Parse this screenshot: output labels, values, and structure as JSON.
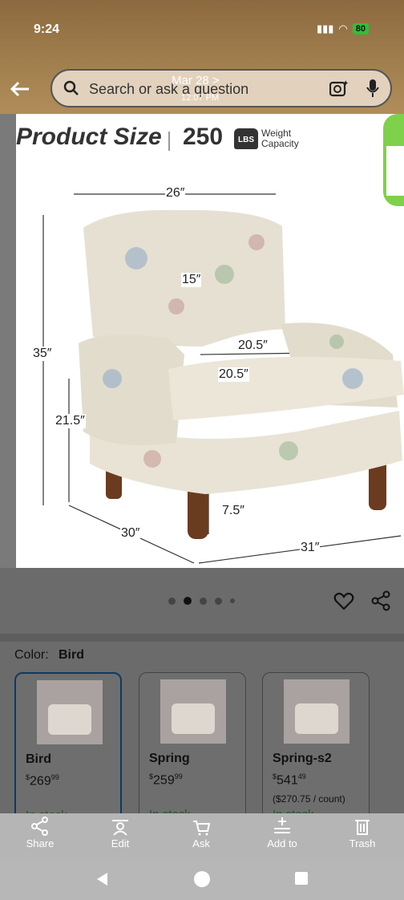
{
  "status": {
    "time": "9:24",
    "battery": "80"
  },
  "search": {
    "placeholder": "Search or ask a question"
  },
  "overlay": {
    "date": "Mar 28 >",
    "time": "12:07 PM"
  },
  "image": {
    "title": "Product Size",
    "capacity_value": "250",
    "capacity_unit": "LBS",
    "capacity_label": "Weight Capacity",
    "dims": {
      "width_top": "26″",
      "back_depth": "15″",
      "seat_width": "20.5″",
      "seat_depth": "20.5″",
      "height": "35″",
      "arm_height": "21.5″",
      "leg_height": "7.5″",
      "depth": "30″",
      "width": "31″"
    }
  },
  "carousel": {
    "count": 5,
    "active_index": 1
  },
  "color": {
    "label": "Color:",
    "value": "Bird"
  },
  "options": [
    {
      "name": "Bird",
      "currency": "$",
      "price": "269",
      "cents": "99",
      "stock": "In stock"
    },
    {
      "name": "Spring",
      "currency": "$",
      "price": "259",
      "cents": "99",
      "stock": "In stock"
    },
    {
      "name": "Spring-s2",
      "currency": "$",
      "price": "541",
      "cents": "49",
      "unit_price": "($270.75 / count)",
      "stock": "In stock"
    }
  ],
  "toolbar": {
    "share": "Share",
    "edit": "Edit",
    "ask": "Ask",
    "add_to": "Add to",
    "trash": "Trash"
  },
  "colors": {
    "header": "#a3804f",
    "selected_border": "#0b3a66",
    "badge_green": "#7fd04a"
  },
  "icons": [
    "search-icon",
    "lens-icon",
    "mic-icon",
    "back-arrow-icon",
    "heart-icon",
    "share-icon",
    "share-tool-icon",
    "edit-tool-icon",
    "ask-tool-icon",
    "add-to-tool-icon",
    "trash-tool-icon"
  ]
}
